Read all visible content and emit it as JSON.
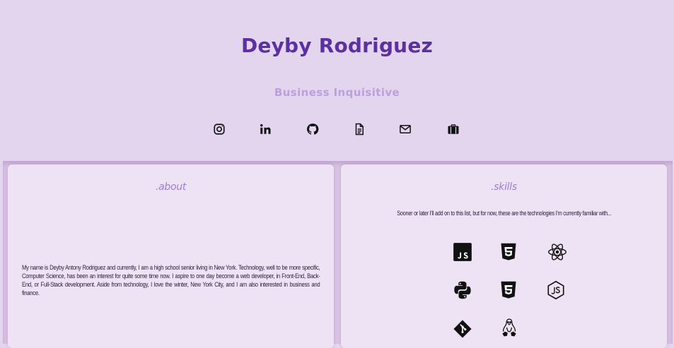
{
  "header": {
    "name": "Deyby Rodriguez",
    "subtitle": "Business Inquisitive",
    "socials": [
      {
        "icon": "instagram-icon"
      },
      {
        "icon": "linkedin-icon"
      },
      {
        "icon": "github-icon"
      },
      {
        "icon": "resume-document-icon"
      },
      {
        "icon": "mail-icon"
      },
      {
        "icon": "briefcase-icon"
      }
    ]
  },
  "about": {
    "title": ".about",
    "text": "My name is Deyby Antony Rodriguez and currently, I am a high school senior living in New York. Technology, well to be more specific, Computer Science, has been an interest for quite some time now. I aspire to one day become a web developer, in Front-End, Back-End, or Full-Stack development. Aside from technology, I love the winter, New York City, and I am also interested in business and finance."
  },
  "skills": {
    "title": ".skills",
    "intro": "Sooner or later I'll add on to this list, but for now, these are the technologies I'm currently familiar with...",
    "icons": [
      "javascript-icon",
      "html5-icon",
      "react-icon",
      "python-icon",
      "css3-icon",
      "nodejs-icon",
      "git-icon",
      "linux-icon"
    ]
  },
  "colors": {
    "background": "#e4d5ef",
    "name": "#5b30a2",
    "subtitle": "#bca0dd",
    "card_title": "#a07ad6",
    "card": "#eee3f4"
  }
}
